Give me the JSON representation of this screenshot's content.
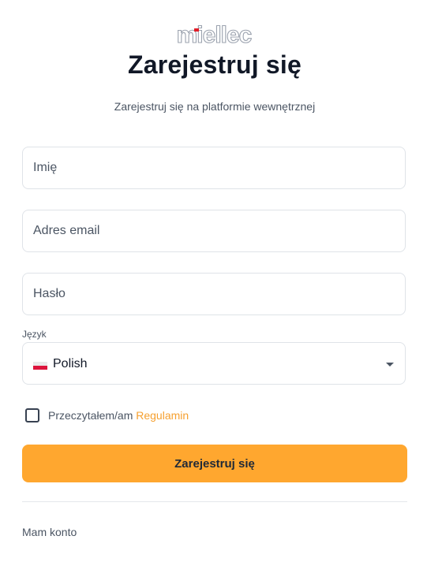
{
  "brand": {
    "logo_text": "miellec",
    "accent_color": "#e11d28",
    "primary_color": "#ffa72f"
  },
  "header": {
    "title": "Zarejestruj się",
    "subtitle": "Zarejestruj się na platformie wewnętrznej"
  },
  "form": {
    "name": {
      "placeholder": "Imię",
      "value": ""
    },
    "email": {
      "placeholder": "Adres email",
      "value": ""
    },
    "password": {
      "placeholder": "Hasło",
      "value": ""
    },
    "language": {
      "label": "Język",
      "selected": "Polish",
      "flag_icon": "poland-flag-icon",
      "dropdown_icon": "caret-down-icon"
    },
    "terms": {
      "checked": false,
      "text": "Przeczytałem/am",
      "link": "Regulamin"
    },
    "submit_label": "Zarejestruj się"
  },
  "footer": {
    "login_link": "Mam konto"
  }
}
